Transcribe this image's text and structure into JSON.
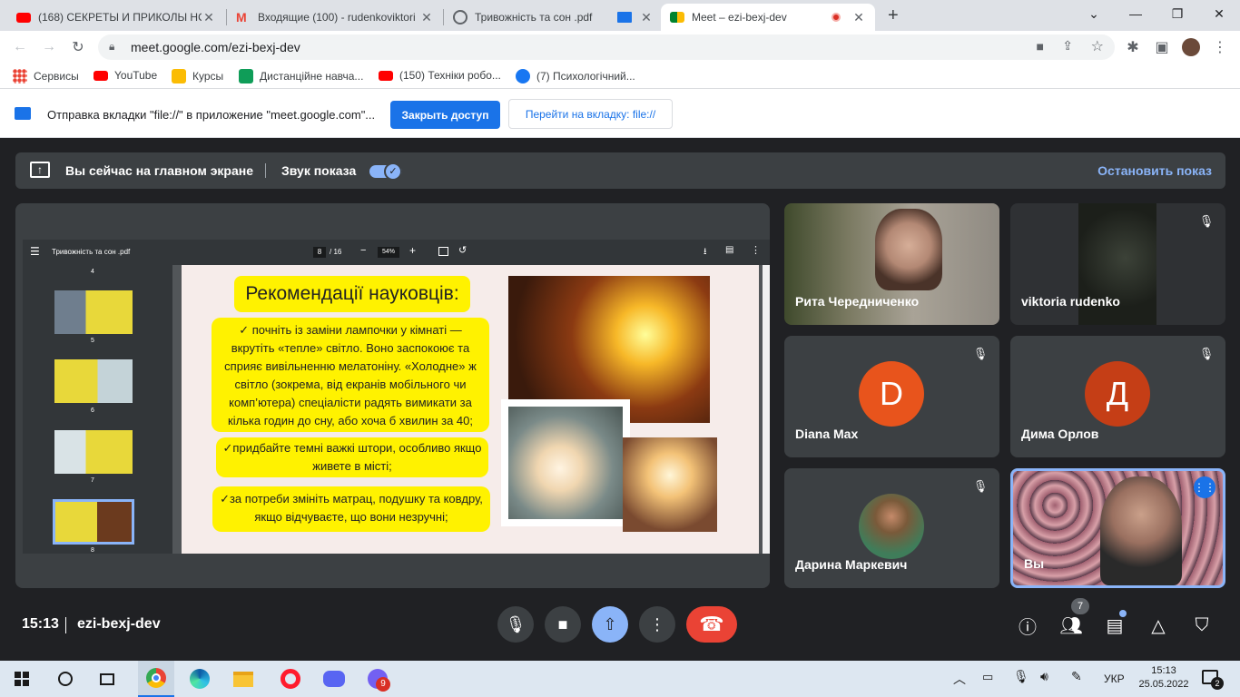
{
  "browser": {
    "tabs": [
      {
        "title": "(168) СЕКРЕТЫ И ПРИКОЛЫ НО",
        "icon": "youtube-icon",
        "color": "#ff0000"
      },
      {
        "title": "Входящие (100) - rudenkoviktori",
        "icon": "gmail-icon",
        "color": "#ea4335"
      },
      {
        "title": "Тривожність та сон .pdf",
        "icon": "globe-icon",
        "color": "#5f6368"
      },
      {
        "title": "",
        "icon": "cast-icon",
        "color": "#1a73e8"
      },
      {
        "title": "Meet – ezi-bexj-dev",
        "icon": "meet-icon",
        "color": "#00832d"
      }
    ],
    "new_tab": "+",
    "url": "meet.google.com/ezi-bexj-dev"
  },
  "bookmarks": [
    {
      "label": "Сервисы"
    },
    {
      "label": "YouTube"
    },
    {
      "label": "Курсы"
    },
    {
      "label": "Дистанційне навча..."
    },
    {
      "label": "(150) Техніки робо..."
    },
    {
      "label": "(7) Психологічний..."
    }
  ],
  "infobar": {
    "message": "Отправка вкладки \"file://\" в приложение \"meet.google.com\"...",
    "stop_label": "Закрыть доступ",
    "switch_label": "Перейти на вкладку: file://"
  },
  "presenting": {
    "title": "Вы сейчас на главном экране",
    "audio_label": "Звук показа",
    "stop_label": "Остановить показ"
  },
  "pdf": {
    "filename": "Тривожність та сон .pdf",
    "page": "8",
    "total": "/ 16",
    "zoom": "54%",
    "thumb_labels": [
      "4",
      "5",
      "6",
      "7",
      "8"
    ],
    "slide_title": "Рекомендації науковців:",
    "para1": "✓ почніть із заміни лампочки у кімнаті — вкрутіть «тепле» світло. Воно заспокоює та сприяє вивільненню мелатоніну. «Холодне» ж світло (зокрема, від екранів мобільного чи комп’ютера) спеціалісти радять вимикати за кілька годин до сну, або хоча б хвилин за 40;",
    "para2": "✓придбайте темні важкі штори, особливо якщо живете в місті;",
    "para3": "✓за потреби змініть матрац, подушку та ковдру, якщо відчуваєте, що вони незручні;"
  },
  "participants": [
    {
      "name": "Рита Чередниченко"
    },
    {
      "name": "viktoria rudenko"
    },
    {
      "name": "Diana Max",
      "initial": "D",
      "color": "#e8541c"
    },
    {
      "name": "Дима Орлов",
      "initial": "Д",
      "color": "#c53e16"
    },
    {
      "name": "Дарина Маркевич"
    },
    {
      "name": "Вы"
    }
  ],
  "meeting": {
    "time": "15:13",
    "code": "ezi-bexj-dev",
    "people_count": "7"
  },
  "taskbar": {
    "lang": "УКР",
    "time": "15:13",
    "date": "25.05.2022",
    "viber_badge": "9",
    "notif_badge": "2"
  }
}
